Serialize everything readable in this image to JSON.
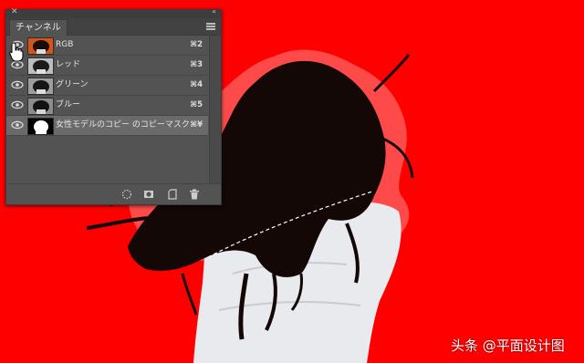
{
  "panel": {
    "tab_label": "チャンネル",
    "close_glyph": "✕",
    "collapse_glyph": "«"
  },
  "channels": [
    {
      "label": "RGB",
      "shortcut": "⌘2",
      "thumb": "photo",
      "selected": false
    },
    {
      "label": "レッド",
      "shortcut": "⌘3",
      "thumb": "gray",
      "selected": false
    },
    {
      "label": "グリーン",
      "shortcut": "⌘4",
      "thumb": "gray",
      "selected": false
    },
    {
      "label": "ブルー",
      "shortcut": "⌘5",
      "thumb": "gray",
      "selected": false
    },
    {
      "label": "女性モデルのコピー のコピーマスク",
      "shortcut": "⌘¥",
      "thumb": "mask",
      "selected": true
    }
  ],
  "toolbar_icons": [
    "load-selection-icon",
    "save-selection-icon",
    "new-channel-icon",
    "trash-icon"
  ],
  "watermark": "头条 @平面设计图",
  "colors": {
    "canvas_bg": "#ff0000",
    "panel_bg": "#535353",
    "selected_row": "#6a6a6a"
  }
}
